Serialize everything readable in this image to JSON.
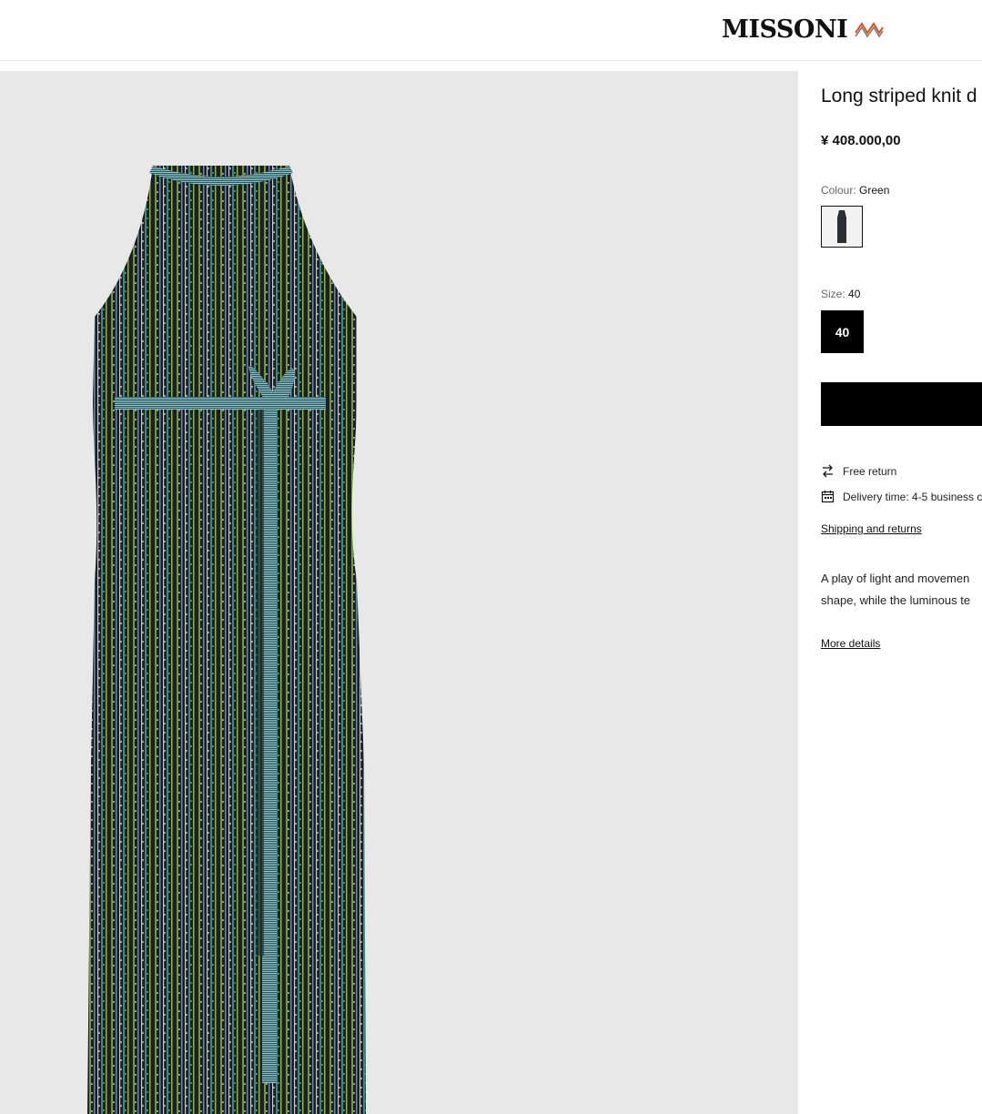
{
  "header": {
    "brand": "MISSONI",
    "logo_icon": "zigzag-logo-icon"
  },
  "product": {
    "title": "Long striped knit d",
    "price": "¥ 408.000,00",
    "colour_label": "Colour:",
    "colour_value": "Green",
    "size_label": "Size:",
    "size_value": "40",
    "size_option": "40",
    "free_return": "Free return",
    "delivery": "Delivery time: 4-5 business c",
    "shipping_link": "Shipping and returns",
    "description_line1": "A play of light and movemen",
    "description_line2": "shape, while the luminous te",
    "more_details": "More details"
  },
  "icons": {
    "return": "swap-arrows-icon",
    "delivery": "calendar-icon"
  },
  "colors": {
    "gallery_bg": "#e8e8e8",
    "accent": "#000000"
  }
}
